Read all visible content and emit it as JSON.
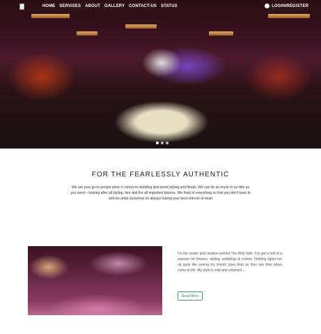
{
  "nav": {
    "items": [
      "HOME",
      "SERVISES",
      "ABOUT",
      "GALLERY",
      "CONTACT-US",
      "STATUS"
    ],
    "login": "LOGIN/REGISTER",
    "login_icon": "user-circle-icon"
  },
  "hero": {
    "slides": 3,
    "active_slide": 1
  },
  "intro": {
    "title": "FOR THE FEARLESSLY AUTHENTIC",
    "text": "We are your go-to people when it comes to wedding and event styling and florals. We can do as much or as little as you need – looking after all styling, hire and the all important blooms. We think of everything so that you don't have to and we pride ourselves on always having your best interest at heart"
  },
  "about": {
    "text": "I'm the owner and creative behind The Wild Side. I've got a hell of a passion for flowers, styling, weddings & events. Nothing lights me up quite like seeing my clients' jaws drop as they see their ideas come to life. My style is wild and untamed ...",
    "button": "Read More",
    "accent": "#3a8a6a"
  }
}
